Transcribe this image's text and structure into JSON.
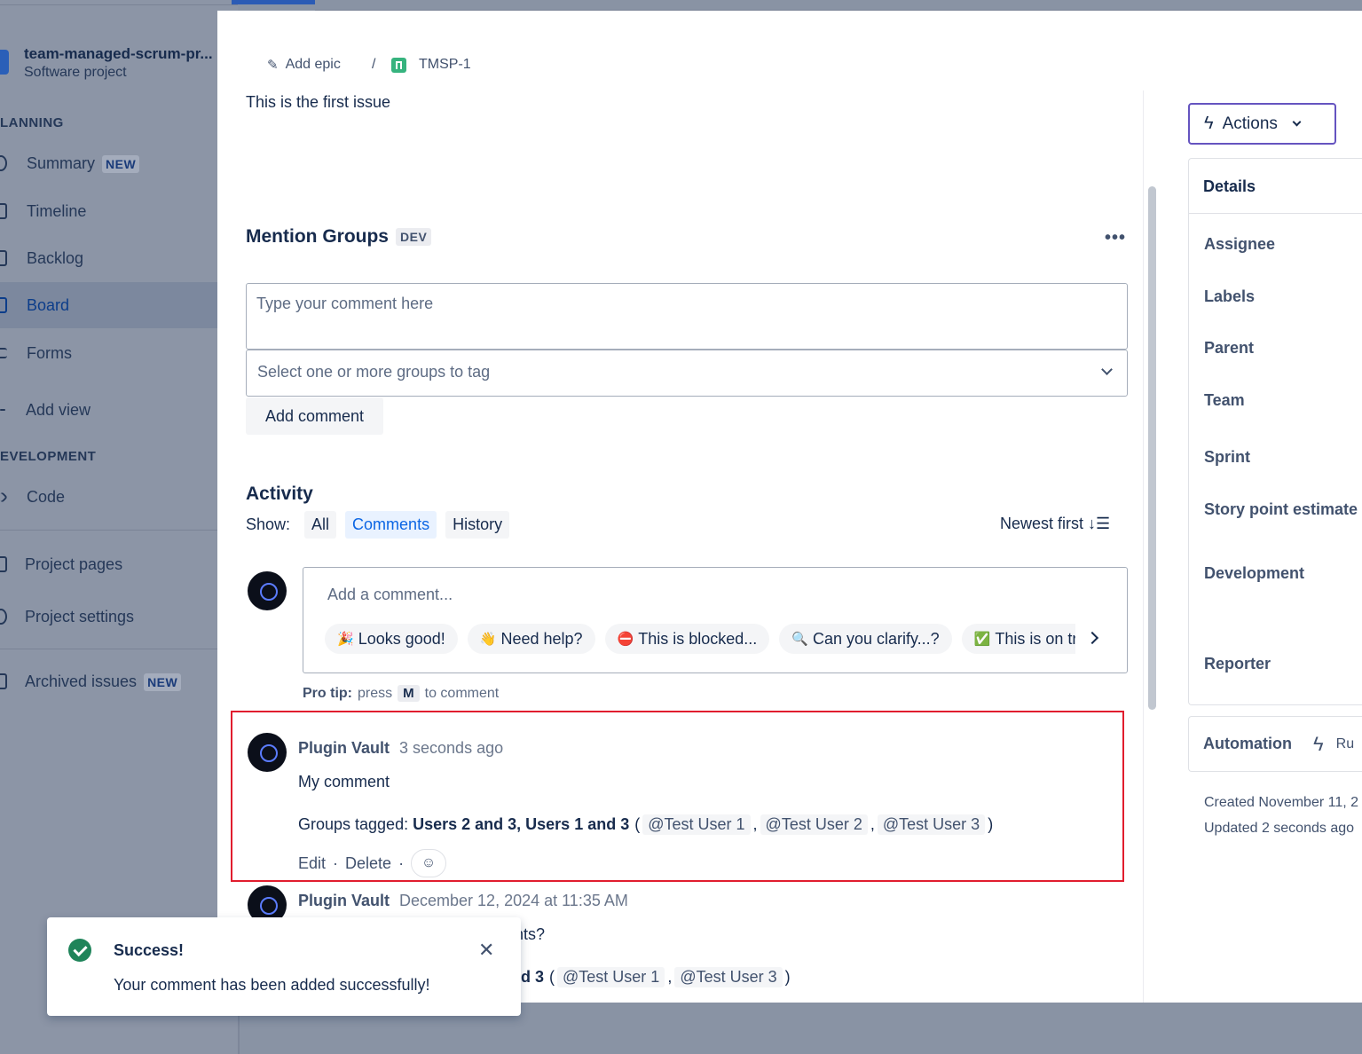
{
  "sidebar": {
    "project_name": "team-managed-scrum-pr...",
    "project_type": "Software project",
    "planning_heading": "LANNING",
    "development_heading": "EVELOPMENT",
    "items": [
      {
        "label": "Summary",
        "badge": "NEW",
        "icon": "globe-icon"
      },
      {
        "label": "Timeline",
        "icon": "timeline-icon"
      },
      {
        "label": "Backlog",
        "icon": "backlog-icon"
      },
      {
        "label": "Board",
        "icon": "board-icon",
        "active": true
      },
      {
        "label": "Forms",
        "icon": "forms-icon"
      },
      {
        "label": "Add view",
        "icon": "plus-icon"
      },
      {
        "label": "Code",
        "icon": "code-icon"
      },
      {
        "label": "Project pages",
        "icon": "page-icon"
      },
      {
        "label": "Project settings",
        "icon": "gear-icon"
      },
      {
        "label": "Archived issues",
        "badge": "NEW",
        "icon": "archive-icon"
      }
    ]
  },
  "breadcrumb": {
    "add_epic": "Add epic",
    "separator": "/",
    "issue_key": "TMSP-1"
  },
  "issue": {
    "description": "This is the first issue"
  },
  "mention_groups": {
    "title": "Mention Groups",
    "badge": "DEV",
    "more": "•••",
    "comment_placeholder": "Type your comment here",
    "group_select_placeholder": "Select one or more groups to tag",
    "add_comment_label": "Add comment"
  },
  "activity": {
    "title": "Activity",
    "show_label": "Show:",
    "filters": [
      {
        "label": "All"
      },
      {
        "label": "Comments",
        "selected": true
      },
      {
        "label": "History"
      }
    ],
    "sort_label": "Newest first ↓☰",
    "comment_box_placeholder": "Add a comment...",
    "quick_replies": [
      {
        "emoji": "🎉",
        "label": "Looks good!"
      },
      {
        "emoji": "👋",
        "label": "Need help?"
      },
      {
        "emoji": "⛔",
        "label": "This is blocked..."
      },
      {
        "emoji": "🔍",
        "label": "Can you clarify...?"
      },
      {
        "emoji": "✅",
        "label": "This is on track"
      }
    ],
    "pro_tip_bold": "Pro tip:",
    "pro_tip_press": "press",
    "pro_tip_key": "M",
    "pro_tip_rest": "to comment"
  },
  "comments": [
    {
      "author": "Plugin Vault",
      "time": "3 seconds ago",
      "body": "My comment",
      "groups_prefix": "Groups tagged:",
      "groups": "Users 2 and 3, Users 1 and 3",
      "users": [
        "@Test User 1",
        "@Test User 2",
        "@Test User 3"
      ],
      "edit": "Edit",
      "delete": "Delete",
      "dot": "·"
    },
    {
      "author": "Plugin Vault",
      "time": "December 12, 2024 at 11:35 AM",
      "body_fragment": "nts?",
      "groups_fragment": "d 3",
      "users": [
        "@Test User 1",
        "@Test User 3"
      ]
    }
  ],
  "right_panel": {
    "actions_label": "Actions",
    "details_title": "Details",
    "fields": [
      "Assignee",
      "Labels",
      "Parent",
      "Team",
      "Sprint",
      "Story point estimate",
      "Development",
      "Reporter"
    ],
    "automation_label": "Automation",
    "automation_rules_fragment": "Ru",
    "created": "Created November 11, 2",
    "updated": "Updated 2 seconds ago"
  },
  "toast": {
    "title": "Success!",
    "message": "Your comment has been added successfully!"
  }
}
